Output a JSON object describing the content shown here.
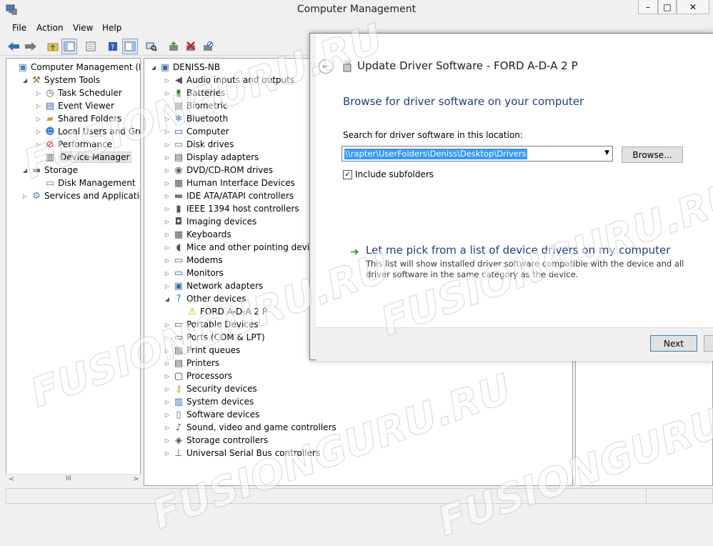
{
  "window": {
    "title": "Computer Management",
    "menu": [
      "File",
      "Action",
      "View",
      "Help"
    ],
    "controls": {
      "minimize": "–",
      "maximize": "□",
      "close": "✕"
    }
  },
  "left_tree": [
    {
      "label": "Computer Management (Local",
      "level": 0,
      "expander": "",
      "icon": "computer-management-icon"
    },
    {
      "label": "System Tools",
      "level": 1,
      "expander": "◢",
      "icon": "system-tools-icon"
    },
    {
      "label": "Task Scheduler",
      "level": 2,
      "expander": "▷",
      "icon": "clock-icon"
    },
    {
      "label": "Event Viewer",
      "level": 2,
      "expander": "▷",
      "icon": "event-viewer-icon"
    },
    {
      "label": "Shared Folders",
      "level": 2,
      "expander": "▷",
      "icon": "shared-folder-icon"
    },
    {
      "label": "Local Users and Groups",
      "level": 2,
      "expander": "▷",
      "icon": "users-icon"
    },
    {
      "label": "Performance",
      "level": 2,
      "expander": "▷",
      "icon": "performance-icon"
    },
    {
      "label": "Device Manager",
      "level": 2,
      "expander": "",
      "icon": "device-manager-icon",
      "selected": true
    },
    {
      "label": "Storage",
      "level": 1,
      "expander": "◢",
      "icon": "storage-icon"
    },
    {
      "label": "Disk Management",
      "level": 2,
      "expander": "",
      "icon": "disk-icon"
    },
    {
      "label": "Services and Applications",
      "level": 1,
      "expander": "▷",
      "icon": "services-icon"
    }
  ],
  "device_tree": [
    {
      "label": "DENISS-NB",
      "level": 0,
      "expander": "◢",
      "icon": "computer-icon"
    },
    {
      "label": "Audio inputs and outputs",
      "level": 1,
      "expander": "▷",
      "icon": "speaker-icon"
    },
    {
      "label": "Batteries",
      "level": 1,
      "expander": "▷",
      "icon": "battery-icon"
    },
    {
      "label": "Biometric",
      "level": 1,
      "expander": "▷",
      "icon": "biometric-icon"
    },
    {
      "label": "Bluetooth",
      "level": 1,
      "expander": "▷",
      "icon": "bluetooth-icon"
    },
    {
      "label": "Computer",
      "level": 1,
      "expander": "▷",
      "icon": "monitor-icon"
    },
    {
      "label": "Disk drives",
      "level": 1,
      "expander": "▷",
      "icon": "disk-icon"
    },
    {
      "label": "Display adapters",
      "level": 1,
      "expander": "▷",
      "icon": "display-adapter-icon"
    },
    {
      "label": "DVD/CD-ROM drives",
      "level": 1,
      "expander": "▷",
      "icon": "dvd-icon"
    },
    {
      "label": "Human Interface Devices",
      "level": 1,
      "expander": "▷",
      "icon": "hid-icon"
    },
    {
      "label": "IDE ATA/ATAPI controllers",
      "level": 1,
      "expander": "▷",
      "icon": "ide-icon"
    },
    {
      "label": "IEEE 1394 host controllers",
      "level": 1,
      "expander": "▷",
      "icon": "ieee1394-icon"
    },
    {
      "label": "Imaging devices",
      "level": 1,
      "expander": "▷",
      "icon": "camera-icon"
    },
    {
      "label": "Keyboards",
      "level": 1,
      "expander": "▷",
      "icon": "keyboard-icon"
    },
    {
      "label": "Mice and other pointing devices",
      "level": 1,
      "expander": "▷",
      "icon": "mouse-icon"
    },
    {
      "label": "Modems",
      "level": 1,
      "expander": "▷",
      "icon": "modem-icon"
    },
    {
      "label": "Monitors",
      "level": 1,
      "expander": "▷",
      "icon": "monitor-icon"
    },
    {
      "label": "Network adapters",
      "level": 1,
      "expander": "▷",
      "icon": "network-icon"
    },
    {
      "label": "Other devices",
      "level": 1,
      "expander": "◢",
      "icon": "unknown-device-icon"
    },
    {
      "label": "FORD A-D-A 2 P",
      "level": 2,
      "expander": "",
      "icon": "warning-device-icon"
    },
    {
      "label": "Portable Devices",
      "level": 1,
      "expander": "▷",
      "icon": "portable-device-icon"
    },
    {
      "label": "Ports (COM & LPT)",
      "level": 1,
      "expander": "▷",
      "icon": "port-icon"
    },
    {
      "label": "Print queues",
      "level": 1,
      "expander": "▷",
      "icon": "printer-icon"
    },
    {
      "label": "Printers",
      "level": 1,
      "expander": "▷",
      "icon": "printer-icon"
    },
    {
      "label": "Processors",
      "level": 1,
      "expander": "▷",
      "icon": "processor-icon"
    },
    {
      "label": "Security devices",
      "level": 1,
      "expander": "▷",
      "icon": "key-icon"
    },
    {
      "label": "System devices",
      "level": 1,
      "expander": "▷",
      "icon": "system-device-icon"
    },
    {
      "label": "Software devices",
      "level": 1,
      "expander": "▷",
      "icon": "software-device-icon"
    },
    {
      "label": "Sound, video and game controllers",
      "level": 1,
      "expander": "▷",
      "icon": "sound-icon"
    },
    {
      "label": "Storage controllers",
      "level": 1,
      "expander": "▷",
      "icon": "storage-controller-icon"
    },
    {
      "label": "Universal Serial Bus controllers",
      "level": 1,
      "expander": "▷",
      "icon": "usb-icon"
    }
  ],
  "hscroll": {
    "thumb": "III",
    "left_arrow": "<",
    "right_arrow": ">"
  },
  "dialog": {
    "title": "Update Driver Software - FORD A-D-A 2 P",
    "heading": "Browse for driver software on your computer",
    "search_label": "Search for driver software in this location:",
    "path_value": "\\\\rapter\\UserFolders\\Deniss\\Desktop\\Drivers",
    "browse_label": "Browse...",
    "include_subfolders_label": "Include subfolders",
    "include_subfolders_checked": true,
    "pick_title": "Let me pick from a list of device drivers on my computer",
    "pick_desc": "This list will show installed driver software compatible with the device and all driver software in the same category as the device.",
    "next_label": "Next",
    "cancel_label": "C"
  },
  "watermark": "FUSIONGURU.RU"
}
